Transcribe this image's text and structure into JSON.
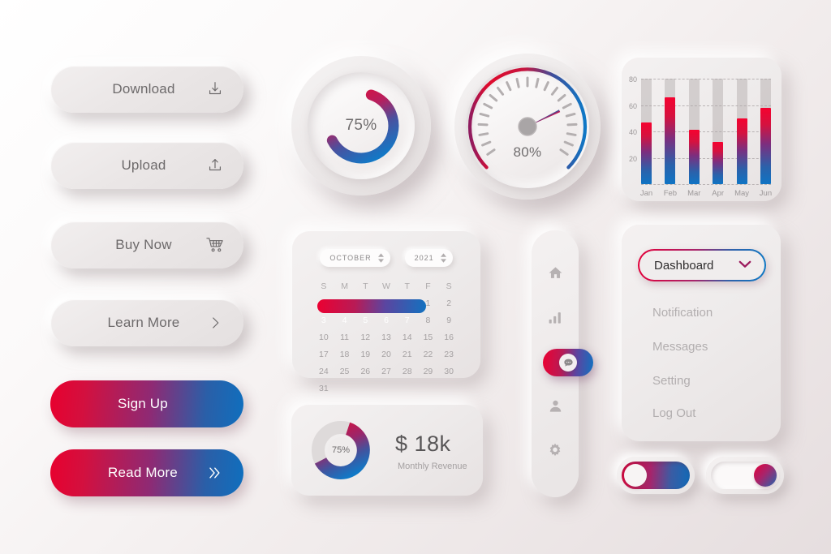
{
  "theme": {
    "accent_red": "#e4003a",
    "accent_blue": "#0f6fbe",
    "surface": "#eeebeb",
    "text_muted": "#9b9798"
  },
  "left_buttons": [
    {
      "label": "Download",
      "icon": "download-icon",
      "style": "neumorphic"
    },
    {
      "label": "Upload",
      "icon": "upload-icon",
      "style": "neumorphic"
    },
    {
      "label": "Buy Now",
      "icon": "cart-icon",
      "style": "neumorphic"
    },
    {
      "label": "Learn More",
      "icon": "chevron-right-icon",
      "style": "neumorphic"
    },
    {
      "label": "Sign Up",
      "icon": "",
      "style": "gradient"
    },
    {
      "label": "Read More",
      "icon": "double-chevron-right-icon",
      "style": "gradient"
    }
  ],
  "progress_knob": {
    "value_label": "75%",
    "percent": 75
  },
  "speedometer": {
    "value_label": "80%",
    "percent": 80,
    "tick_count": 21
  },
  "chart_data": {
    "type": "bar",
    "title": "",
    "categories": [
      "Jan",
      "Feb",
      "Mar",
      "Apr",
      "May",
      "Jun"
    ],
    "values": [
      47,
      66,
      41,
      32,
      50,
      58
    ],
    "track_max": 80,
    "ylim": [
      0,
      80
    ],
    "yticks": [
      20,
      40,
      60,
      80
    ],
    "ytick_labels": [
      "20",
      "40",
      "60",
      "80"
    ],
    "xlabel": "",
    "ylabel": "",
    "grid": true,
    "legend": "none"
  },
  "calendar": {
    "month": "OCTOBER",
    "year": "2021",
    "dow": [
      "S",
      "M",
      "T",
      "W",
      "T",
      "F",
      "S"
    ],
    "lead_blanks": 5,
    "days": [
      1,
      2,
      3,
      4,
      5,
      6,
      7,
      8,
      9,
      10,
      11,
      12,
      13,
      14,
      15,
      16,
      17,
      18,
      19,
      20,
      21,
      22,
      23,
      24,
      25,
      26,
      27,
      28,
      29,
      30,
      31
    ],
    "selected_range": [
      3,
      4,
      5,
      6,
      7
    ]
  },
  "revenue_card": {
    "donut_label": "75%",
    "donut_percent": 75,
    "amount": "$ 18k",
    "caption": "Monthly Revenue"
  },
  "nav_rail": {
    "items": [
      {
        "icon": "home-icon",
        "active": false
      },
      {
        "icon": "bar-chart-icon",
        "active": false
      },
      {
        "icon": "chat-icon",
        "active": true
      },
      {
        "icon": "person-icon",
        "active": false
      },
      {
        "icon": "gear-icon",
        "active": false
      }
    ]
  },
  "dropdown": {
    "selected": "Dashboard",
    "chevron": "chevron-down-icon",
    "items": [
      "Notification",
      "Messages",
      "Setting",
      "Log Out"
    ]
  },
  "toggles": [
    {
      "state": "on",
      "knob_side": "left"
    },
    {
      "state": "off",
      "knob_side": "right"
    }
  ]
}
